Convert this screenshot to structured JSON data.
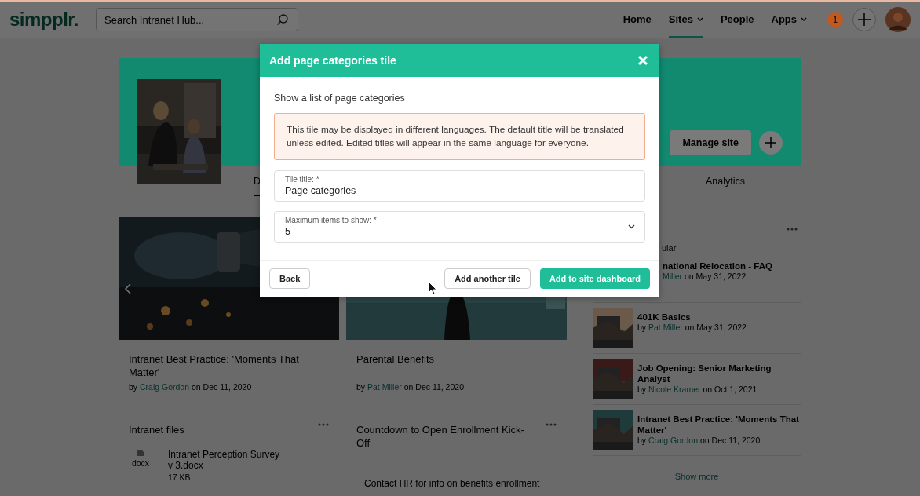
{
  "header": {
    "logo": "simpplr.",
    "search": {
      "placeholder": "Search Intranet Hub..."
    },
    "nav": [
      {
        "label": "Home",
        "selected": false,
        "caret": false
      },
      {
        "label": "Sites",
        "selected": true,
        "caret": true
      },
      {
        "label": "People",
        "selected": false,
        "caret": false
      },
      {
        "label": "Apps",
        "selected": false,
        "caret": true
      }
    ],
    "notifications": "1"
  },
  "site_hero": {
    "manage_button": "Manage site",
    "tabs": [
      {
        "label": "D",
        "selected": true
      },
      {
        "label": "Analytics",
        "selected": false
      }
    ]
  },
  "feature_cards": [
    {
      "title": "Intranet Best Practice: 'Moments That Matter'",
      "by": "by",
      "author": "Craig Gordon",
      "date": "on Dec 11, 2020"
    },
    {
      "title": "Parental Benefits",
      "by": "by",
      "author": "Pat Miller",
      "date": "on Dec 11, 2020"
    }
  ],
  "files_tile": {
    "title": "Intranet files",
    "files": [
      {
        "type": "docx",
        "name": "Intranet Perception Survey v 3.docx",
        "size": "17 KB"
      }
    ]
  },
  "countdown_tile": {
    "title": "Countdown to Open Enrollment Kick-Off",
    "body": "Contact HR for info on benefits enrollment"
  },
  "popular_tile": {
    "heading": "ular",
    "show_more": "Show more",
    "items": [
      {
        "title": "national Relocation - FAQ",
        "author": "Miller",
        "date": "on May 31, 2022"
      },
      {
        "title": "401K Basics",
        "by": "by",
        "author": "Pat Miller",
        "date": "on May 31, 2022"
      },
      {
        "title": "Job Opening: Senior Marketing Analyst",
        "by": "by",
        "author": "Nicole Kramer",
        "date": "on Oct 1, 2021"
      },
      {
        "title": "Intranet Best Practice: 'Moments That Matter'",
        "by": "by",
        "author": "Craig Gordon",
        "date": "on Dec 11, 2020"
      }
    ]
  },
  "modal": {
    "title": "Add page categories tile",
    "description": "Show a list of page categories",
    "notice": "This tile may be displayed in different languages. The default title will be translated unless edited. Edited titles will appear in the same language for everyone.",
    "fields": [
      {
        "kind": "text",
        "label": "Tile title: *",
        "value": "Page categories"
      },
      {
        "kind": "select",
        "label": "Maximum items to show: *",
        "value": "5"
      }
    ],
    "buttons": [
      {
        "kind": "secondary",
        "label": "Back"
      },
      {
        "kind": "secondary",
        "label": "Add another tile"
      },
      {
        "kind": "primary",
        "label": "Add to site dashboard"
      }
    ]
  }
}
